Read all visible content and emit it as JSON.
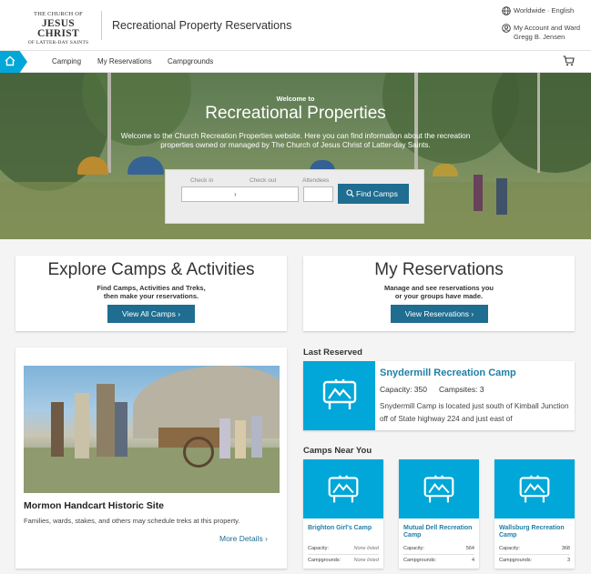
{
  "header": {
    "logo": {
      "line1": "THE CHURCH OF",
      "line2": "JESUS CHRIST",
      "line3": "OF LATTER-DAY SAINTS"
    },
    "app_title": "Recreational Property Reservations",
    "language": "Worldwide · English",
    "account_label": "My Account and Ward",
    "user_name": "Gregg B. Jensen"
  },
  "nav": {
    "items": [
      "Camping",
      "My Reservations",
      "Campgrounds"
    ]
  },
  "hero": {
    "welcome_small": "Welcome to",
    "welcome_big": "Recreational Properties",
    "description": "Welcome to the Church Recreation Properties website. Here you can find information about the recreation properties owned or managed by The Church of Jesus Christ of Latter-day Saints.",
    "search": {
      "checkin_label": "Check in",
      "checkout_label": "Check out",
      "attendees_label": "Attendees",
      "arrow": "›",
      "button": "Find Camps"
    }
  },
  "explore": {
    "title": "Explore Camps & Activities",
    "sub1": "Find Camps, Activities and Treks,",
    "sub2": "then make your reservations.",
    "button": "View All Camps ›"
  },
  "reservations": {
    "title": "My Reservations",
    "sub1": "Manage and see reservations you",
    "sub2": "or your groups have made.",
    "button": "View Reservations ›"
  },
  "featured": {
    "title": "Mormon Handcart Historic Site",
    "description": "Families, wards, stakes, and others may schedule treks at this property.",
    "link": "More Details ›"
  },
  "last_reserved": {
    "heading": "Last Reserved",
    "name": "Snydermill Recreation Camp",
    "capacity": "Capacity: 350",
    "campsites": "Campsites: 3",
    "description": "Snydermill Camp is located just south of Kimball Junction off of State highway 224 and just east of"
  },
  "camps_near": {
    "heading": "Camps Near You",
    "capacity_label": "Capacity:",
    "campgrounds_label": "Campgrounds:",
    "camps": [
      {
        "name": "Brighton Girl's Camp",
        "capacity": "None listed",
        "campgrounds": "None listed"
      },
      {
        "name": "Mutual Dell Recreation Camp",
        "capacity": "564",
        "campgrounds": "4"
      },
      {
        "name": "Wallsburg Recreation Camp",
        "capacity": "368",
        "campgrounds": "3"
      }
    ]
  },
  "colors": {
    "accent": "#00a7d8",
    "button": "#1f6d90",
    "link": "#1f7fa8"
  }
}
